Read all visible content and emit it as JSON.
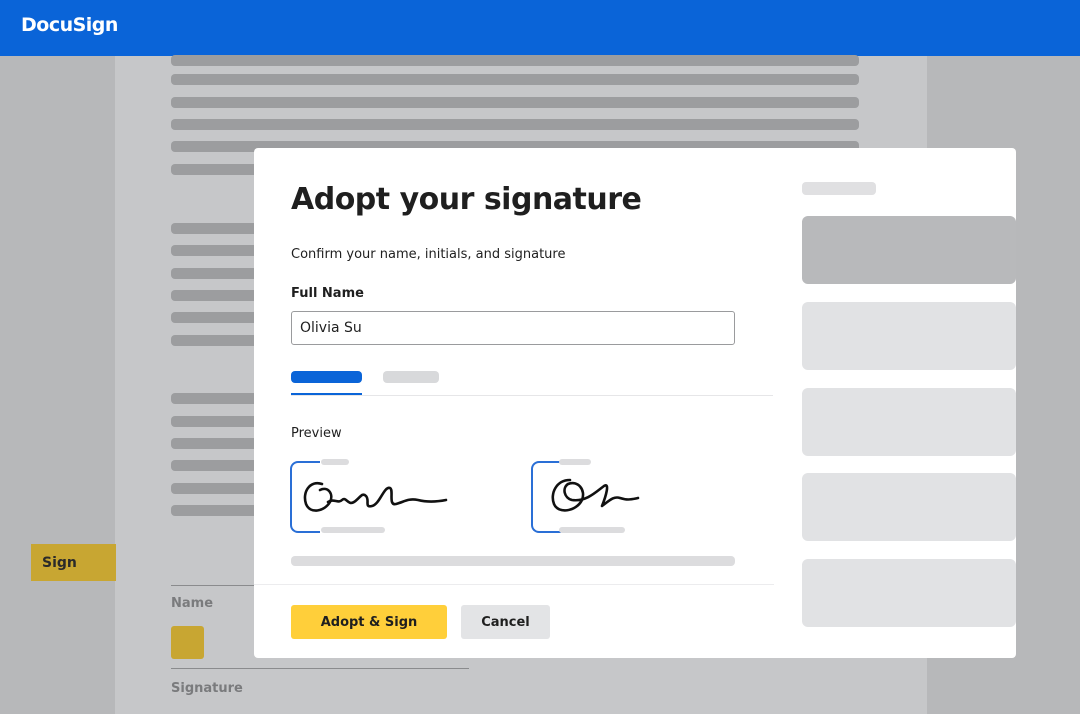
{
  "header": {
    "brand": "DocuSign"
  },
  "document": {
    "sign_tab_label": "Sign",
    "name_label": "Name",
    "signature_label": "Signature"
  },
  "modal": {
    "title": "Adopt your signature",
    "subtitle": "Confirm your name, initials, and signature",
    "full_name_label": "Full Name",
    "full_name_value": "Olivia Su",
    "preview_label": "Preview",
    "adopt_button": "Adopt & Sign",
    "cancel_button": "Cancel"
  },
  "colors": {
    "brand_blue": "#0a64d8",
    "adopt_yellow": "#ffcf3a",
    "sign_tab_gold": "#c8a632"
  }
}
